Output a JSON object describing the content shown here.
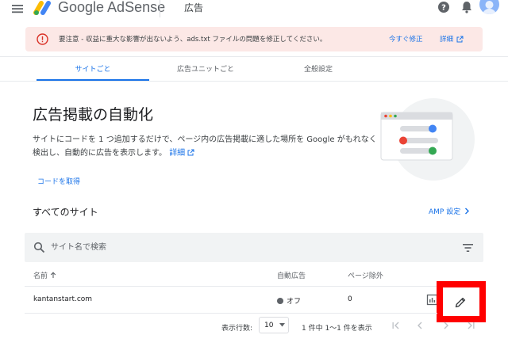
{
  "header": {
    "brand": "Google AdSense",
    "page_title": "広告",
    "icons": [
      "menu-icon",
      "adsense-logo",
      "help-icon",
      "notifications-icon",
      "avatar"
    ]
  },
  "alert": {
    "text": "要注意 - 収益に重大な影響が出ないよう、ads.txt ファイルの問題を修正してください。",
    "fix_label": "今すぐ修正",
    "details_label": "詳細",
    "icon": "error-icon"
  },
  "tabs": [
    {
      "label": "サイトごと",
      "active": true
    },
    {
      "label": "広告ユニットごと",
      "active": false
    },
    {
      "label": "全般設定",
      "active": false
    }
  ],
  "hero": {
    "title": "広告掲載の自動化",
    "description": "サイトにコードを 1 つ追加するだけで、ページ内の広告掲載に適した場所を Google がもれなく検出し、自動的に広告を表示します。",
    "learn_more": "詳細",
    "get_code": "コードを取得"
  },
  "sites": {
    "heading": "すべてのサイト",
    "amp_settings": "AMP 設定",
    "search_placeholder": "サイト名で検索",
    "columns": {
      "name": "名前",
      "auto_ads": "自動広告",
      "page_exclusions": "ページ除外"
    },
    "rows": [
      {
        "name": "kantanstart.com",
        "auto_ads": "オフ",
        "page_exclusions": "0"
      }
    ],
    "footer": {
      "rows_per_page_label": "表示行数:",
      "rows_per_page": "10",
      "range": "1 件中 1〜1 件を表示"
    }
  },
  "colors": {
    "accent": "#1a73e8",
    "alert_bg": "#fce8e6",
    "alert_icon": "#d93025",
    "highlight_box": "#ff0000"
  }
}
